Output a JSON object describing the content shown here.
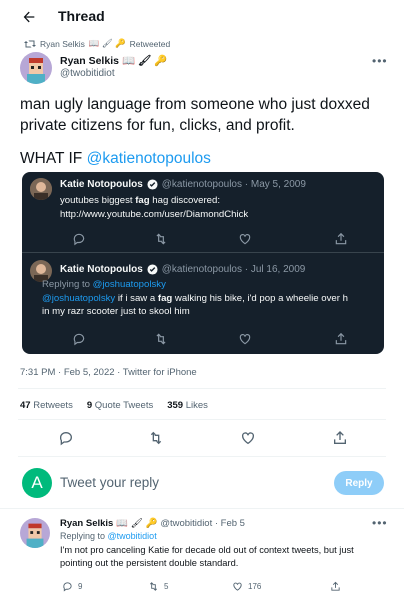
{
  "header": {
    "title": "Thread"
  },
  "retweet": {
    "by": "Ryan Selkis",
    "emoji": "📖 🖌 🔑",
    "label": "Retweeted"
  },
  "tweet": {
    "author_name": "Ryan Selkis",
    "author_emoji": "📖 🖌 🔑",
    "author_handle": "@twobitidiot",
    "text_line1": "man ugly language from someone who just doxxed",
    "text_line2": "private citizens for fun, clicks, and profit.",
    "text_line3_prefix": "WHAT IF ",
    "text_line3_mention": "@katienotopoulos",
    "timestamp": "7:31 PM · Feb 5, 2022 · Twitter for iPhone",
    "stats": {
      "retweets_count": "47",
      "retweets_label": "Retweets",
      "quotes_count": "9",
      "quotes_label": "Quote Tweets",
      "likes_count": "359",
      "likes_label": "Likes"
    }
  },
  "quoted": [
    {
      "name": "Katie Notopoulos",
      "handle_date": "@katienotopoulos · May 5, 2009",
      "line1_pre": "youtubes biggest ",
      "line1_bold": "fag",
      "line1_post": " hag discovered:",
      "line2": "http://www.youtube.com/user/DiamondChick"
    },
    {
      "name": "Katie Notopoulos",
      "handle_date": "@katienotopoulos · Jul 16, 2009",
      "replying_prefix": "Replying to ",
      "replying_handle": "@joshuatopolsky",
      "line1_mention": "@joshuatopolsky",
      "line1_pre": " if i saw a ",
      "line1_bold": "fag",
      "line1_post": " walking his bike, i'd pop a wheelie over h",
      "line2": "in my razr scooter just to skool him"
    }
  ],
  "reply_box": {
    "avatar_letter": "A",
    "placeholder": "Tweet your reply",
    "button": "Reply"
  },
  "reply": {
    "author_name": "Ryan Selkis",
    "author_emoji": "📖 🖌 🔑",
    "handle_date": "@twobitidiot · Feb 5",
    "replying_prefix": "Replying to ",
    "replying_handle": "@twobitidiot",
    "text_line1": "I'm not pro canceling Katie for decade old out of context tweets, but just",
    "text_line2": "pointing out the persistent double standard.",
    "replies_count": "9",
    "retweets_count": "5",
    "likes_count": "176"
  },
  "colors": {
    "accent": "#1d9bf0",
    "dark_card": "#15202b",
    "muted": "#536471"
  }
}
